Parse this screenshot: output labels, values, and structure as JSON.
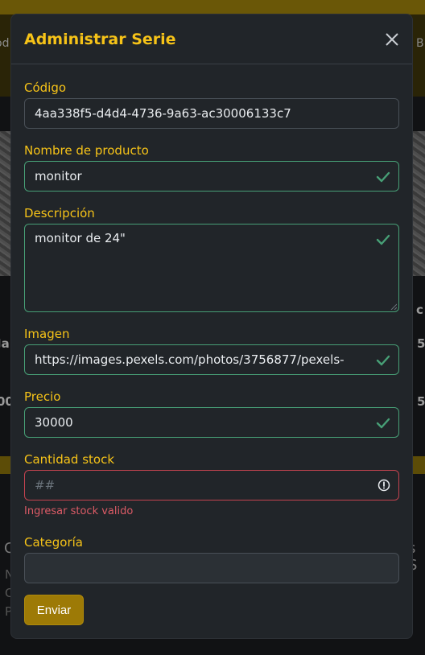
{
  "background": {
    "nav_left": "od",
    "nav_right": "B",
    "row1_left": "Ja",
    "row1_right": "5",
    "row2_left": "00",
    "row2_right": "5",
    "col_right": "c",
    "foot_left": "C",
    "foot_right": "s S",
    "foot_small1": "N",
    "foot_small2": "C",
    "foot_small3": "P"
  },
  "modal": {
    "title": "Administrar Serie",
    "close_icon": "close-icon"
  },
  "form": {
    "codigo": {
      "label": "Código",
      "value": "4aa338f5-d4d4-4736-9a63-ac30006133c7"
    },
    "nombre": {
      "label": "Nombre de producto",
      "value": "monitor"
    },
    "descripcion": {
      "label": "Descripción",
      "value": "monitor de 24\""
    },
    "imagen": {
      "label": "Imagen",
      "value": "https://images.pexels.com/photos/3756877/pexels-"
    },
    "precio": {
      "label": "Precio",
      "value": "30000"
    },
    "stock": {
      "label": "Cantidad stock",
      "placeholder": "##",
      "error": "Ingresar stock valido"
    },
    "categoria": {
      "label": "Categoría",
      "value": ""
    },
    "submit_label": "Enviar"
  },
  "colors": {
    "accent": "#f6c318",
    "valid": "#479f76",
    "invalid": "#c2434f",
    "button": "#9d7a06"
  }
}
